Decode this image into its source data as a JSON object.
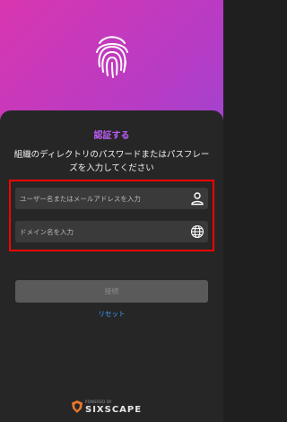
{
  "auth": {
    "title": "認証する",
    "description": "組織のディレクトリのパスワードまたはパスフレーズを入力してください",
    "username_placeholder": "ユーザー名またはメールアドレスを入力",
    "domain_placeholder": "ドメイン名を入力",
    "submit_label": "接続",
    "reset_label": "リセット"
  },
  "footer": {
    "powered_by": "POWERED BY",
    "brand": "SIXSCAPE"
  },
  "icons": {
    "header": "fingerprint-icon",
    "username": "person-icon",
    "domain": "globe-icon",
    "logo": "shield-logo-icon"
  },
  "colors": {
    "gradient_start": "#d936b0",
    "gradient_end": "#6b5be6",
    "card_bg": "#262626",
    "title": "#b85cf0",
    "link": "#3aa0ff",
    "highlight": "#ff0000"
  }
}
